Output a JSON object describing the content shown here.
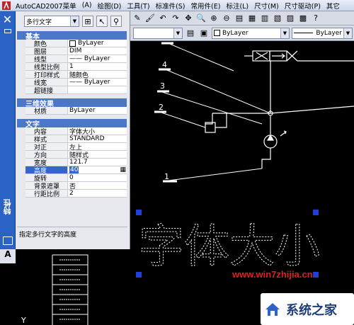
{
  "titlebar": {
    "app_title": "AutoCAD2007菜单",
    "menus": [
      "(A)",
      "绘图(D)",
      "工具(T)",
      "标准件(S)",
      "常用件(E)",
      "标注(L)",
      "尺寸(M)",
      "尺寸驱动(P)",
      "其它"
    ]
  },
  "layer_bar": {
    "linetype_value": "ByLayer",
    "lineweight_value": "ByLayer"
  },
  "properties_panel": {
    "object_type": "多行文字",
    "strip_label": "特性",
    "sections": [
      {
        "title": "基本",
        "rows": [
          {
            "key": "颜色",
            "value": "ByLayer",
            "swatch": true
          },
          {
            "key": "图层",
            "value": "DIM"
          },
          {
            "key": "线型",
            "value": "—— ByLayer"
          },
          {
            "key": "线型比例",
            "value": "1"
          },
          {
            "key": "打印样式",
            "value": "随颜色"
          },
          {
            "key": "线宽",
            "value": "—— ByLayer"
          },
          {
            "key": "超链接",
            "value": ""
          }
        ]
      },
      {
        "title": "三维效果",
        "rows": [
          {
            "key": "材质",
            "value": "ByLayer"
          }
        ]
      },
      {
        "title": "文字",
        "rows": [
          {
            "key": "内容",
            "value": "字体大小"
          },
          {
            "key": "样式",
            "value": "STANDARD"
          },
          {
            "key": "对正",
            "value": "左上"
          },
          {
            "key": "方向",
            "value": "随样式"
          },
          {
            "key": "宽度",
            "value": "121.7"
          },
          {
            "key": "高度",
            "value": "40",
            "selected": true
          },
          {
            "key": "旋转",
            "value": "0"
          },
          {
            "key": "背景遮罩",
            "value": "否"
          },
          {
            "key": "行距比例",
            "value": "2"
          }
        ]
      }
    ],
    "description": "指定多行文字的高度"
  },
  "canvas": {
    "big_text": "字体大小",
    "labels": [
      "1",
      "2",
      "3",
      "4"
    ],
    "left_letter": "A",
    "axis_label": "Y"
  },
  "watermark": {
    "url": "www.win7zhijia.cn",
    "logo_text": "系统之家"
  },
  "colors": {
    "panel_blue": "#2b63c4",
    "section_header": "#4a77c7",
    "selection": "#3467c9",
    "grip_blue": "#1f3fd6",
    "watermark_red": "#e21f1f"
  }
}
